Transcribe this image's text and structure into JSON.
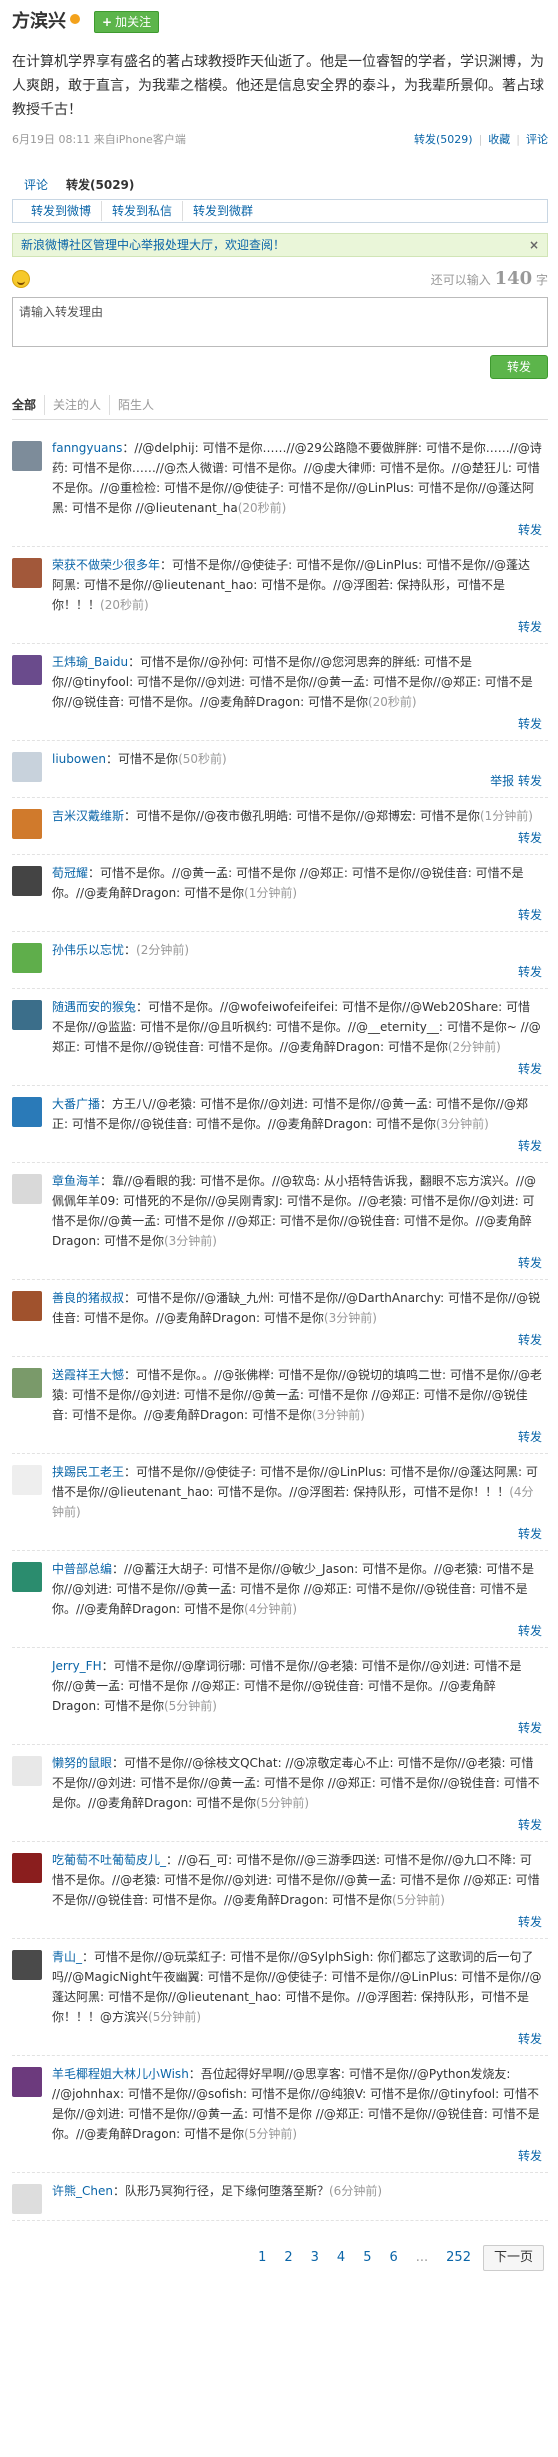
{
  "header": {
    "author": "方滨兴",
    "follow_label": "加关注"
  },
  "post": {
    "text": "在计算机学界享有盛名的著占球教授昨天仙逝了。他是一位睿智的学者，学识渊博，为人爽朗，敢于直言，为我辈之楷模。他还是信息安全界的泰斗，为我辈所景仰。著占球教授千古！",
    "meta": "6月19日 08:11 来自iPhone客户端",
    "forward": "转发(5029)",
    "favorite": "收藏",
    "comment": "评论"
  },
  "tabs": {
    "comment": "评论",
    "forward": "转发(5029)"
  },
  "subtabs": [
    "转发到微博",
    "转发到私信",
    "转发到微群"
  ],
  "notice": {
    "text": "新浪微博社区管理中心举报处理大厅，欢迎查阅！",
    "close": "×"
  },
  "composer": {
    "count_label": "还可以输入",
    "count": "140",
    "unit": "字",
    "placeholder": "请输入转发理由",
    "send": "转发"
  },
  "filter": [
    "全部",
    "关注的人",
    "陌生人"
  ],
  "items": [
    {
      "color": "#7d8c9a",
      "name": "fanngyuans",
      "text": "：//@delphij: 可惜不是你……//@29公路隐不要做胖胖: 可惜不是你……//@诗药: 可惜不是你……//@杰人微谱: 可惜不是你。//@虔大律师: 可惜不是你。//@楚狂儿: 可惜不是你。//@重检检: 可惜不是你//@使徒子: 可惜不是你//@LinPlus: 可惜不是你//@蓬达阿黑: 可惜不是你 //@lieutenant_ha",
      "time": "(20秒前)",
      "acts": "转发"
    },
    {
      "color": "#a2583a",
      "name": "荣获不做荣少很多年",
      "text": "：可惜不是你//@使徒子: 可惜不是你//@LinPlus: 可惜不是你//@蓬达阿黑: 可惜不是你//@lieutenant_hao: 可惜不是你。//@浮图若: 保持队形，可惜不是你！！！",
      "time": "(20秒前)",
      "acts": "转发"
    },
    {
      "color": "#6a4b8c",
      "name": "王炜瑜_Baidu",
      "text": "：可惜不是你//@孙何: 可惜不是你//@您河思奔的胖纸: 可惜不是你//@tinyfool: 可惜不是你//@刘进: 可惜不是你//@黄一孟: 可惜不是你//@郑正: 可惜不是你//@锐佳音: 可惜不是你。//@麦角醉Dragon: 可惜不是你",
      "time": "(20秒前)",
      "acts": "转发"
    },
    {
      "color": "#c8d2dc",
      "name": "liubowen",
      "text": "：可惜不是你",
      "time": "(50秒前)",
      "acts": "举报  转发"
    },
    {
      "color": "#d07a2c",
      "name": "吉米汉戴维斯",
      "text": "：可惜不是你//@夜市傲孔明皓: 可惜不是你//@郑博宏: 可惜不是你",
      "time": "(1分钟前)",
      "acts": "转发"
    },
    {
      "color": "#444444",
      "name": "荀冠耀",
      "text": "：可惜不是你。//@黄一孟: 可惜不是你 //@郑正: 可惜不是你//@锐佳音: 可惜不是你。//@麦角醉Dragon: 可惜不是你",
      "time": "(1分钟前)",
      "acts": "转发"
    },
    {
      "color": "#5fae4b",
      "name": "孙伟乐以忘忧",
      "text": "：",
      "time": "(2分钟前)",
      "acts": "转发"
    },
    {
      "color": "#3b6e8a",
      "name": "随遇而安的猴兔",
      "text": "：可惜不是你。//@wofeiwofeifeifei: 可惜不是你//@Web20Share: 可惜不是你//@监监: 可惜不是你//@且听枫约: 可惜不是你。//@__eternity__: 可惜不是你~ //@郑正: 可惜不是你//@锐佳音: 可惜不是你。//@麦角醉Dragon: 可惜不是你",
      "time": "(2分钟前)",
      "acts": "转发"
    },
    {
      "color": "#2a7ab8",
      "name": "大番广播",
      "text": "：方王八//@老猿: 可惜不是你//@刘进: 可惜不是你//@黄一孟: 可惜不是你//@郑正: 可惜不是你//@锐佳音: 可惜不是你。//@麦角醉Dragon: 可惜不是你",
      "time": "(3分钟前)",
      "acts": "转发"
    },
    {
      "color": "#d9d9d9",
      "name": "章鱼海羊",
      "text": "：靠//@看眼的我: 可惜不是你。//@软岛: 从小捂特告诉我，翻眼不忘方滨兴。//@佩佩年羊09: 可惜死的不是你//@吴刚青家J: 可惜不是你。//@老猿: 可惜不是你//@刘进: 可惜不是你//@黄一孟: 可惜不是你 //@郑正: 可惜不是你//@锐佳音: 可惜不是你。//@麦角醉Dragon: 可惜不是你",
      "time": "(3分钟前)",
      "acts": "转发"
    },
    {
      "color": "#a0522d",
      "name": "善良的猪叔叔",
      "text": "：可惜不是你//@潘缺_九州: 可惜不是你//@DarthAnarchy: 可惜不是你//@锐佳音: 可惜不是你。//@麦角醉Dragon: 可惜不是你",
      "time": "(3分钟前)",
      "acts": "转发"
    },
    {
      "color": "#7a9a6a",
      "name": "送霞祥王大憾",
      "text": "：可惜不是你。。//@张佛榉: 可惜不是你//@锐切的填鸣二世: 可惜不是你//@老猿: 可惜不是你//@刘进: 可惜不是你//@黄一孟: 可惜不是你 //@郑正: 可惜不是你//@锐佳音: 可惜不是你。//@麦角醉Dragon: 可惜不是你",
      "time": "(3分钟前)",
      "acts": "转发"
    },
    {
      "color": "#eeeeee",
      "name": "挟踢民工老王",
      "text": "：可惜不是你//@使徒子: 可惜不是你//@LinPlus: 可惜不是你//@蓬达阿黑: 可惜不是你//@lieutenant_hao: 可惜不是你。//@浮图若: 保持队形，可惜不是你！！！",
      "time": "(4分钟前)",
      "acts": "转发"
    },
    {
      "color": "#2b8c6e",
      "name": "中普部总编",
      "text": "：//@蓄汪大胡子: 可惜不是你//@敏少_Jason: 可惜不是你。//@老猿: 可惜不是你//@刘进: 可惜不是你//@黄一孟: 可惜不是你 //@郑正: 可惜不是你//@锐佳音: 可惜不是你。//@麦角醉Dragon: 可惜不是你",
      "time": "(4分钟前)",
      "acts": "转发"
    },
    {
      "color": "#ffffff",
      "name": "Jerry_FH",
      "text": "：可惜不是你//@摩词衍哪: 可惜不是你//@老猿: 可惜不是你//@刘进: 可惜不是你//@黄一孟: 可惜不是你 //@郑正: 可惜不是你//@锐佳音: 可惜不是你。//@麦角醉Dragon: 可惜不是你",
      "time": "(5分钟前)",
      "acts": "转发"
    },
    {
      "color": "#e8e8e8",
      "name": "懒努的鼠眼",
      "text": "：可惜不是你//@徐枝文QChat: //@凉敬定毒心不止: 可惜不是你//@老猿: 可惜不是你//@刘进: 可惜不是你//@黄一孟: 可惜不是你 //@郑正: 可惜不是你//@锐佳音: 可惜不是你。//@麦角醉Dragon: 可惜不是你",
      "time": "(5分钟前)",
      "acts": "转发"
    },
    {
      "color": "#8a1e1e",
      "name": "吃葡萄不吐葡萄皮儿_",
      "text": "：//@石_可: 可惜不是你//@三游季四送: 可惜不是你//@九口不降: 可惜不是你。//@老猿: 可惜不是你//@刘进: 可惜不是你//@黄一孟: 可惜不是你 //@郑正: 可惜不是你//@锐佳音: 可惜不是你。//@麦角醉Dragon: 可惜不是你",
      "time": "(5分钟前)",
      "acts": "转发"
    },
    {
      "color": "#4a4a4a",
      "name": "青山_",
      "text": "：可惜不是你//@玩菜紅子: 可惜不是你//@SylphSigh: 你们都忘了这歌词的后一句了吗//@MagicNight午夜幽翼: 可惜不是你//@使徒子: 可惜不是你//@LinPlus: 可惜不是你//@蓬达阿黑: 可惜不是你//@lieutenant_hao: 可惜不是你。//@浮图若: 保持队形，可惜不是你！！！@方滨兴",
      "time": "(5分钟前)",
      "acts": "转发"
    },
    {
      "color": "#6c3a7d",
      "name": "羊毛椰程姐大林儿小Wish",
      "text": "：吾位起得好早啊//@思享客: 可惜不是你//@Python发烧友: //@johnhax: 可惜不是你//@sofish: 可惜不是你//@纯狼V: 可惜不是你//@tinyfool: 可惜不是你//@刘进: 可惜不是你//@黄一孟: 可惜不是你 //@郑正: 可惜不是你//@锐佳音: 可惜不是你。//@麦角醉Dragon: 可惜不是你",
      "time": "(5分钟前)",
      "acts": "转发"
    },
    {
      "color": "#dddddd",
      "name": "许熊_Chen",
      "text": "：队形乃冥狗行径，足下缘何堕落至斯？",
      "time": "(6分钟前)",
      "acts": ""
    }
  ],
  "pager": {
    "pages": [
      "1",
      "2",
      "3",
      "4",
      "5",
      "6"
    ],
    "dots": "...",
    "last": "252",
    "next": "下一页"
  }
}
